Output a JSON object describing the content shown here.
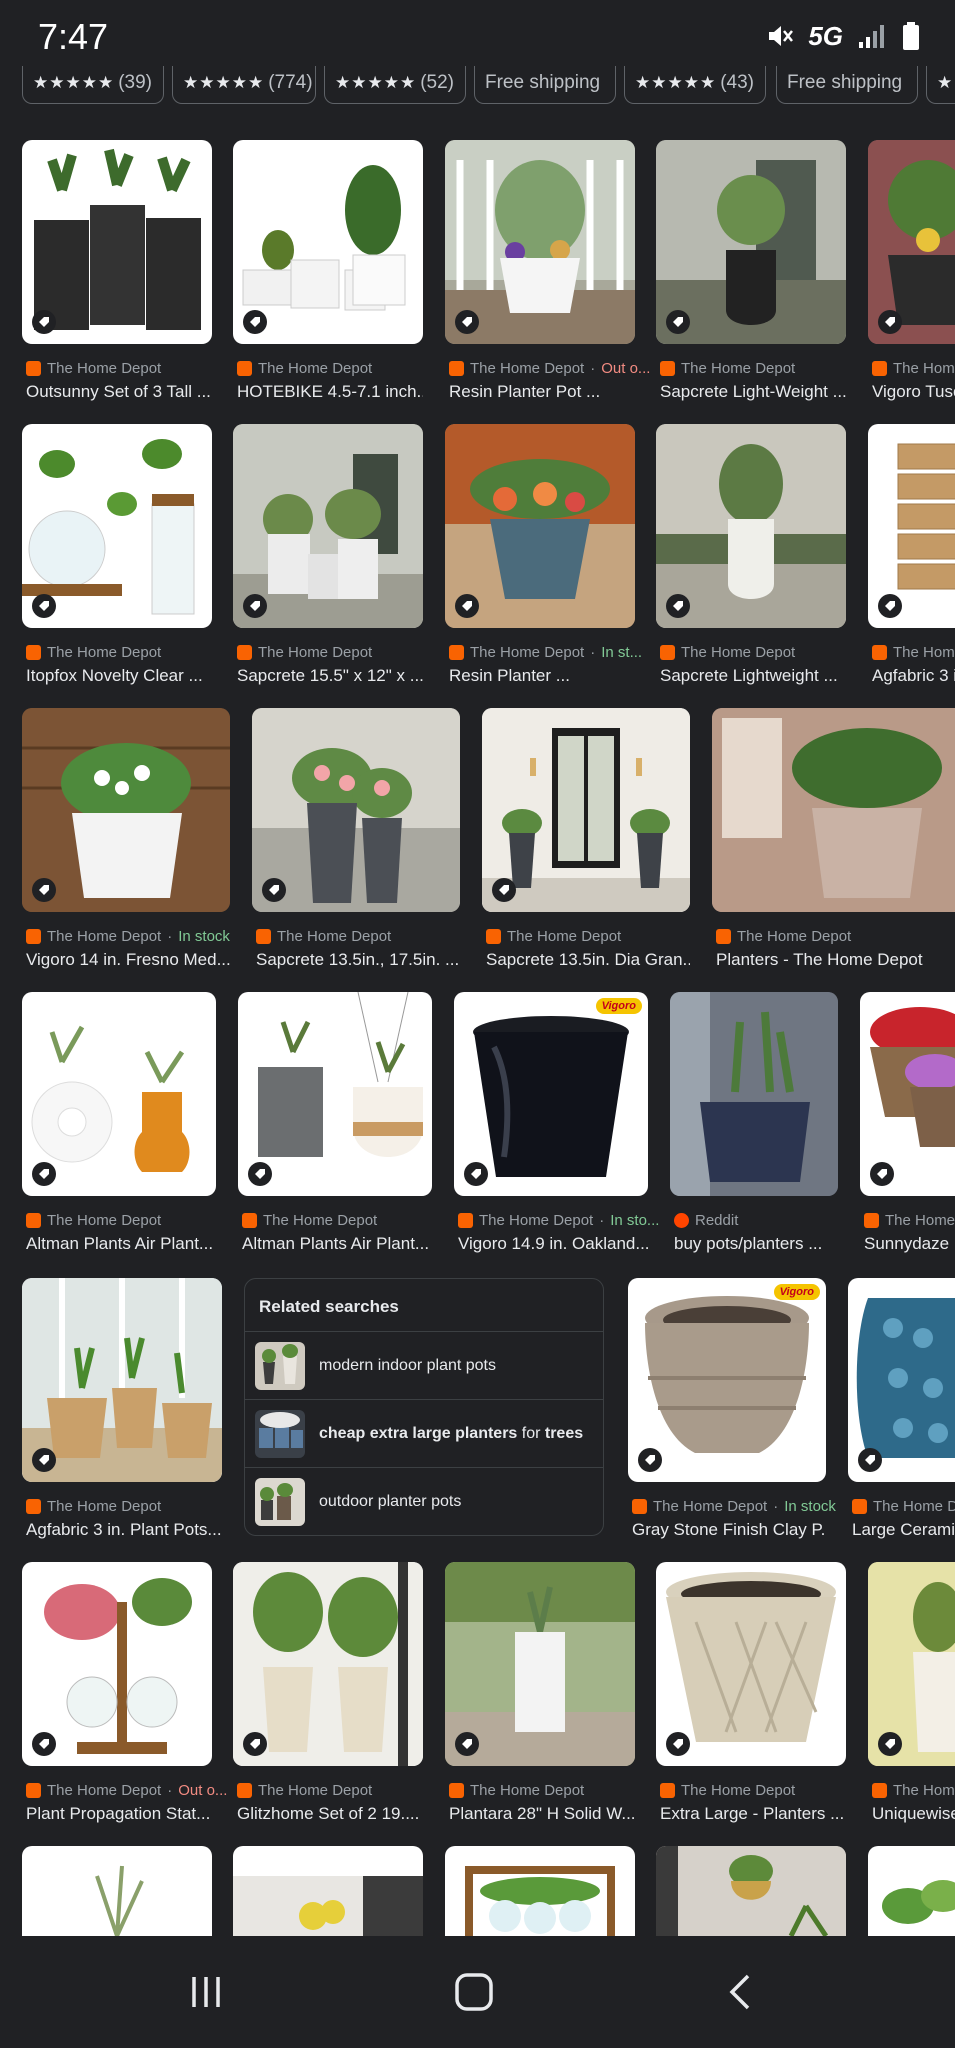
{
  "status": {
    "time": "7:47",
    "network": "5G"
  },
  "chips": [
    {
      "stars": "★★★★★",
      "count": "(39)"
    },
    {
      "stars": "★★★★★",
      "count": "(774)"
    },
    {
      "stars": "★★★★★",
      "count": "(52)"
    },
    {
      "label": "Free shipping"
    },
    {
      "stars": "★★★★★",
      "count": "(43)"
    },
    {
      "label": "Free shipping"
    },
    {
      "stars": "★"
    }
  ],
  "results": [
    {
      "source": "The Home Depot",
      "title": "Outsunny Set of 3 Tall ..."
    },
    {
      "source": "The Home Depot",
      "title": "HOTEBIKE 4.5-7.1 inch..."
    },
    {
      "source": "The Home Depot",
      "availability": "Out o...",
      "title": "Resin Planter Pot ..."
    },
    {
      "source": "The Home Depot",
      "title": "Sapcrete Light-Weight ..."
    },
    {
      "source": "The Home",
      "title": "Vigoro Tusc"
    },
    {
      "source": "The Home Depot",
      "title": "Itopfox Novelty Clear ..."
    },
    {
      "source": "The Home Depot",
      "title": "Sapcrete 15.5\" x 12\" x ..."
    },
    {
      "source": "The Home Depot",
      "availability": "In st...",
      "title": "Resin Planter ..."
    },
    {
      "source": "The Home Depot",
      "title": "Sapcrete Lightweight ..."
    },
    {
      "source": "The Home",
      "title": "Agfabric 3 i"
    },
    {
      "source": "The Home Depot",
      "availability": "In stock",
      "title": "Vigoro 14 in. Fresno Med..."
    },
    {
      "source": "The Home Depot",
      "title": "Sapcrete 13.5in., 17.5in. ..."
    },
    {
      "source": "The Home Depot",
      "title": "Sapcrete 13.5in. Dia Gran..."
    },
    {
      "source": "The Home Depot",
      "title": "Planters - The Home Depot"
    },
    {
      "source": "The Home Depot",
      "title": "Altman Plants Air Plant..."
    },
    {
      "source": "The Home Depot",
      "title": "Altman Plants Air Plant..."
    },
    {
      "source": "The Home Depot",
      "availability": "In sto...",
      "title": "Vigoro 14.9 in. Oakland..."
    },
    {
      "source": "Reddit",
      "title": "buy pots/planters ..."
    },
    {
      "source": "The Home D",
      "title": "Sunnydaze D"
    },
    {
      "source": "The Home Depot",
      "title": "Agfabric 3 in. Plant Pots..."
    },
    {
      "source": "The Home Depot",
      "availability": "In stock",
      "title": "Gray Stone Finish Clay P..."
    },
    {
      "source": "The Home De",
      "title": "Large Ceramic"
    },
    {
      "source": "The Home Depot",
      "availability": "Out o...",
      "title": "Plant Propagation Stat..."
    },
    {
      "source": "The Home Depot",
      "title": "Glitzhome Set of 2 19...."
    },
    {
      "source": "The Home Depot",
      "title": "Plantara 28\" H Solid W..."
    },
    {
      "source": "The Home Depot",
      "title": "Extra Large - Planters ..."
    },
    {
      "source": "The Home",
      "title": "Uniquewise"
    }
  ],
  "badges": {
    "vigoro": "Vigoro"
  },
  "related": {
    "heading": "Related searches",
    "items": [
      {
        "text": "modern indoor plant pots"
      },
      {
        "parts": [
          "cheap extra large planters",
          " for ",
          "trees"
        ]
      },
      {
        "text": "outdoor planter pots"
      }
    ]
  },
  "colors": {
    "background": "#202124",
    "text": "#e8eaed",
    "muted": "#9aa0a6",
    "green": "#81c995",
    "red": "#f28b82",
    "homedepot": "#f96302"
  }
}
